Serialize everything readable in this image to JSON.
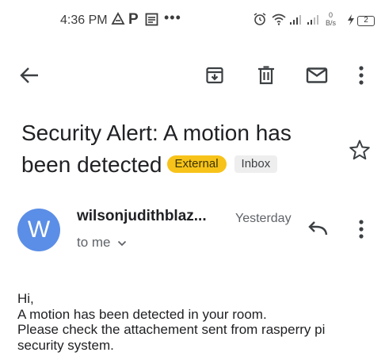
{
  "status_bar": {
    "time": "4:36 PM",
    "p_glyph": "P",
    "more_dots": "•••",
    "speed_value": "0",
    "speed_unit": "B/s",
    "battery_level": "2",
    "icons": [
      "drive-icon",
      "p-icon",
      "message-icon",
      "alarm-icon",
      "wifi-icon",
      "signal-icon",
      "signal-icon-2",
      "charging-icon",
      "battery-icon"
    ]
  },
  "toolbar": {
    "icons": [
      "back-arrow-icon",
      "archive-icon",
      "delete-icon",
      "mark-unread-icon",
      "more-vert-icon"
    ]
  },
  "email": {
    "subject_line1": "Security Alert: A motion has",
    "subject_line2": "been detected",
    "label_external": "External",
    "label_inbox": "Inbox",
    "sender_initial": "W",
    "sender_name": "wilsonjudithblaz...",
    "date": "Yesterday",
    "recipient": "to me",
    "body": [
      "Hi,",
      "A motion has been detected in your room.",
      "Please check the attachement sent from rasperry pi",
      "security system."
    ]
  },
  "colors": {
    "avatar": "#5b8ee6",
    "external_label": "#f7c31a",
    "inbox_label": "#eeeeee",
    "text": "#202124",
    "secondary_text": "#5f6368"
  }
}
